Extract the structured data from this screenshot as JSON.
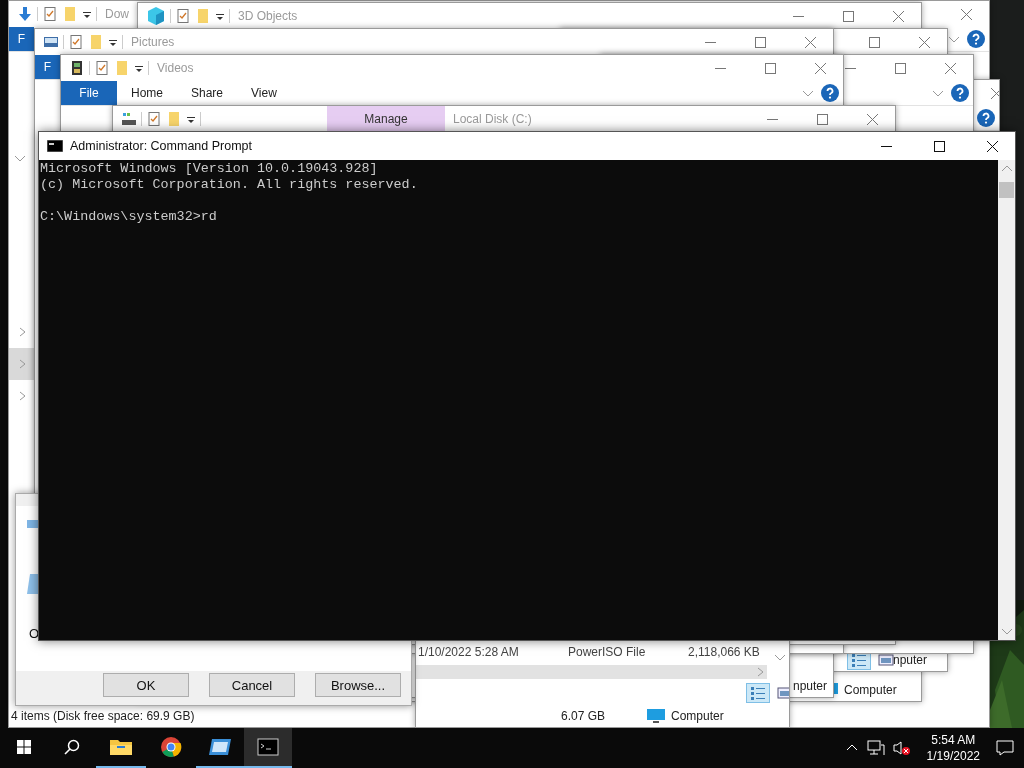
{
  "windows": [
    {
      "title": "Dow",
      "ribbon": {
        "file_tab": "F",
        "help_button": true
      },
      "nav_items": [
        {
          "selected": false
        },
        {
          "selected": true
        },
        {
          "selected": false
        }
      ],
      "status": {
        "text": "4 items (Disk free space: 69.9 GB)"
      }
    },
    {
      "title": "3D Objects",
      "status": {
        "location": "Computer",
        "location_icon": true
      }
    },
    {
      "view_modes": [
        {
          "selected": true
        },
        {
          "selected": false
        }
      ],
      "status": {
        "location": "nputer",
        "location_icon": false
      }
    },
    {
      "title": "Pictures",
      "ribbon": {
        "file_tab": "F"
      },
      "status": {
        "location": "nputer",
        "location_icon": false
      }
    },
    {
      "ribbon": {
        "help_button": true
      }
    },
    {
      "ribbon": {
        "help_button": true
      }
    },
    {
      "title": "Videos",
      "ribbon": {
        "file_tab": "File",
        "tabs": [
          "Home",
          "Share",
          "View"
        ],
        "help_button": true
      }
    },
    {
      "title": "Local Disk (C:)",
      "context_tab": "Manage"
    },
    {
      "file_row": [
        "1/10/2022 5:28 AM",
        "PowerISO File",
        "2,118,066 KB"
      ],
      "view_modes": [
        {
          "selected": true
        },
        {
          "selected": false
        }
      ],
      "status": {
        "size": "6.07 GB",
        "location": "Computer",
        "location_icon": true
      }
    }
  ],
  "dialog": {
    "text": "O",
    "buttons": [
      "OK",
      "Cancel",
      "Browse..."
    ]
  },
  "console": {
    "title": "Administrator: Command Prompt",
    "output": [
      "Microsoft Windows [Version 10.0.19043.928]",
      "(c) Microsoft Corporation. All rights reserved."
    ],
    "prompt": "C:\\Windows\\system32>rd"
  },
  "taskbar": {
    "items": [
      {
        "kind": "start",
        "running": false,
        "selected": false
      },
      {
        "kind": "search",
        "running": false,
        "selected": false
      },
      {
        "kind": "explorer",
        "running": true,
        "selected": false
      },
      {
        "kind": "browser",
        "running": false,
        "selected": false
      },
      {
        "kind": "app",
        "running": true,
        "selected": false
      },
      {
        "kind": "terminal",
        "running": true,
        "selected": true
      }
    ],
    "time": "5:54 AM",
    "date": "1/19/2022"
  }
}
